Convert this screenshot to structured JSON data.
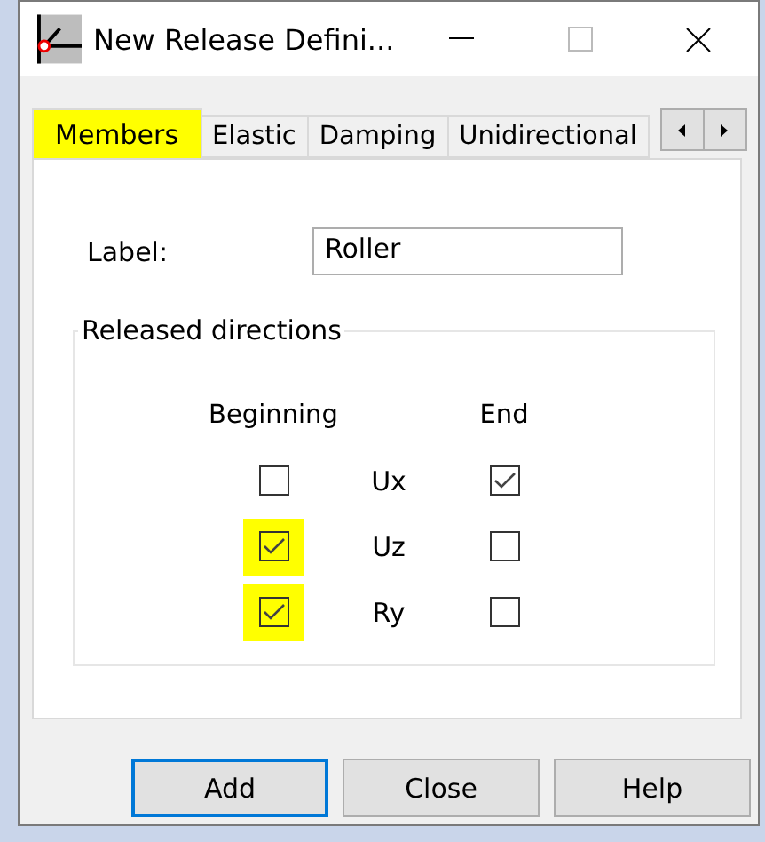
{
  "window": {
    "title": "New Release Defini..."
  },
  "tabs": [
    {
      "label": "Members",
      "selected": true,
      "highlighted": true
    },
    {
      "label": "Elastic",
      "selected": false,
      "highlighted": false
    },
    {
      "label": "Damping",
      "selected": false,
      "highlighted": false
    },
    {
      "label": "Unidirectional",
      "selected": false,
      "highlighted": false
    }
  ],
  "label_field": {
    "label": "Label:",
    "value": "Roller"
  },
  "released_directions": {
    "title": "Released directions",
    "column_headers": [
      "Beginning",
      "End"
    ],
    "rows": [
      {
        "name": "Ux",
        "beginning": {
          "checked": false,
          "highlighted": false
        },
        "end": {
          "checked": true,
          "highlighted": false
        }
      },
      {
        "name": "Uz",
        "beginning": {
          "checked": true,
          "highlighted": true
        },
        "end": {
          "checked": false,
          "highlighted": false
        }
      },
      {
        "name": "Ry",
        "beginning": {
          "checked": true,
          "highlighted": true
        },
        "end": {
          "checked": false,
          "highlighted": false
        }
      }
    ]
  },
  "buttons": [
    {
      "label": "Add",
      "default": true
    },
    {
      "label": "Close",
      "default": false
    },
    {
      "label": "Help",
      "default": false
    }
  ]
}
